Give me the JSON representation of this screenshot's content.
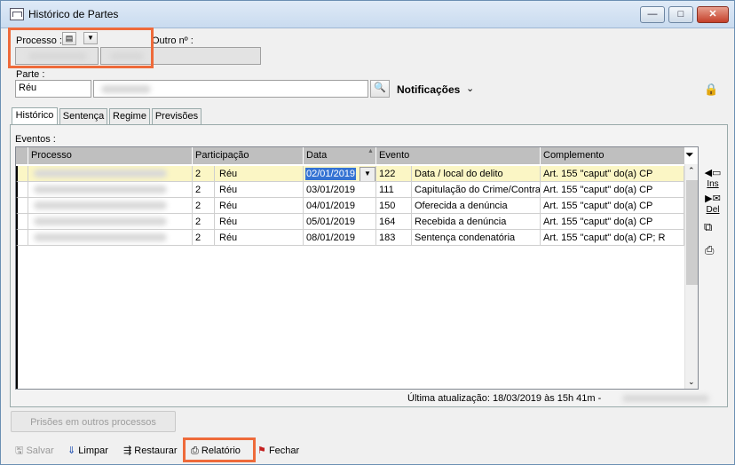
{
  "window": {
    "title": "Histórico de Partes",
    "min": "—",
    "max": "□",
    "close": "✕"
  },
  "form": {
    "processo_label": "Processo :",
    "outro_label": "Outro nº :",
    "parte_label": "Parte :",
    "parte_value": "Réu",
    "notificacoes_label": "Notificações"
  },
  "tabs": [
    "Histórico",
    "Sentença",
    "Regime",
    "Previsões"
  ],
  "eventos_label": "Eventos :",
  "table": {
    "columns": [
      "Processo",
      "Participação",
      "",
      "Data",
      "Evento",
      "",
      "Complemento"
    ],
    "rows": [
      {
        "participacao_num": "2",
        "participacao": "Réu",
        "data": "02/01/2019",
        "evento_num": "122",
        "evento": "Data / local do delito",
        "complemento": "Art. 155 \"caput\" do(a) CP"
      },
      {
        "participacao_num": "2",
        "participacao": "Réu",
        "data": "03/01/2019",
        "evento_num": "111",
        "evento": "Capitulação do Crime/Contrav",
        "complemento": "Art. 155 \"caput\" do(a) CP"
      },
      {
        "participacao_num": "2",
        "participacao": "Réu",
        "data": "04/01/2019",
        "evento_num": "150",
        "evento": "Oferecida a denúncia",
        "complemento": "Art. 155 \"caput\" do(a) CP"
      },
      {
        "participacao_num": "2",
        "participacao": "Réu",
        "data": "05/01/2019",
        "evento_num": "164",
        "evento": "Recebida a denúncia",
        "complemento": "Art. 155 \"caput\" do(a) CP"
      },
      {
        "participacao_num": "2",
        "participacao": "Réu",
        "data": "08/01/2019",
        "evento_num": "183",
        "evento": "Sentença condenatória",
        "complemento": "Art. 155 \"caput\" do(a) CP; R"
      }
    ]
  },
  "side_icons": {
    "ins": "Ins",
    "del": "Del"
  },
  "status": {
    "ultima": "Última atualização:  18/03/2019 às 15h 41m  -"
  },
  "prisoes_button": "Prisões em outros processos",
  "toolbar": {
    "salvar": "Salvar",
    "limpar": "Limpar",
    "restaurar": "Restaurar",
    "relatorio": "Relatório",
    "fechar": "Fechar"
  }
}
